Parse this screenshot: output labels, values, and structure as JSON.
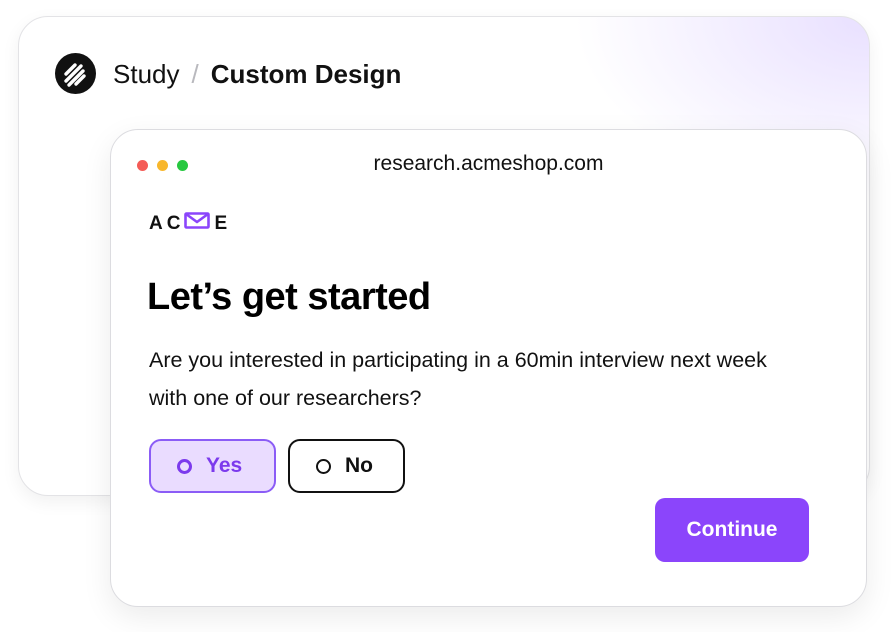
{
  "header": {
    "breadcrumb_root": "Study",
    "breadcrumb_separator": "/",
    "breadcrumb_current": "Custom Design"
  },
  "browser": {
    "url": "research.acmeshop.com",
    "window_controls": [
      {
        "name": "close",
        "color": "#f45b56"
      },
      {
        "name": "minimize",
        "color": "#f8b72c"
      },
      {
        "name": "maximize",
        "color": "#27c840"
      }
    ]
  },
  "survey": {
    "brand_left": "AC",
    "brand_right": "E",
    "brand_icon": "envelope-icon",
    "title": "Let’s get started",
    "question": "Are you interested in participating in a 60min interview next week with one of our researchers?",
    "options": [
      {
        "label": "Yes",
        "selected": true
      },
      {
        "label": "No",
        "selected": false
      }
    ],
    "continue_label": "Continue"
  },
  "colors": {
    "accent": "#8b45fb",
    "accent_light": "#eadcff",
    "text": "#111111"
  }
}
